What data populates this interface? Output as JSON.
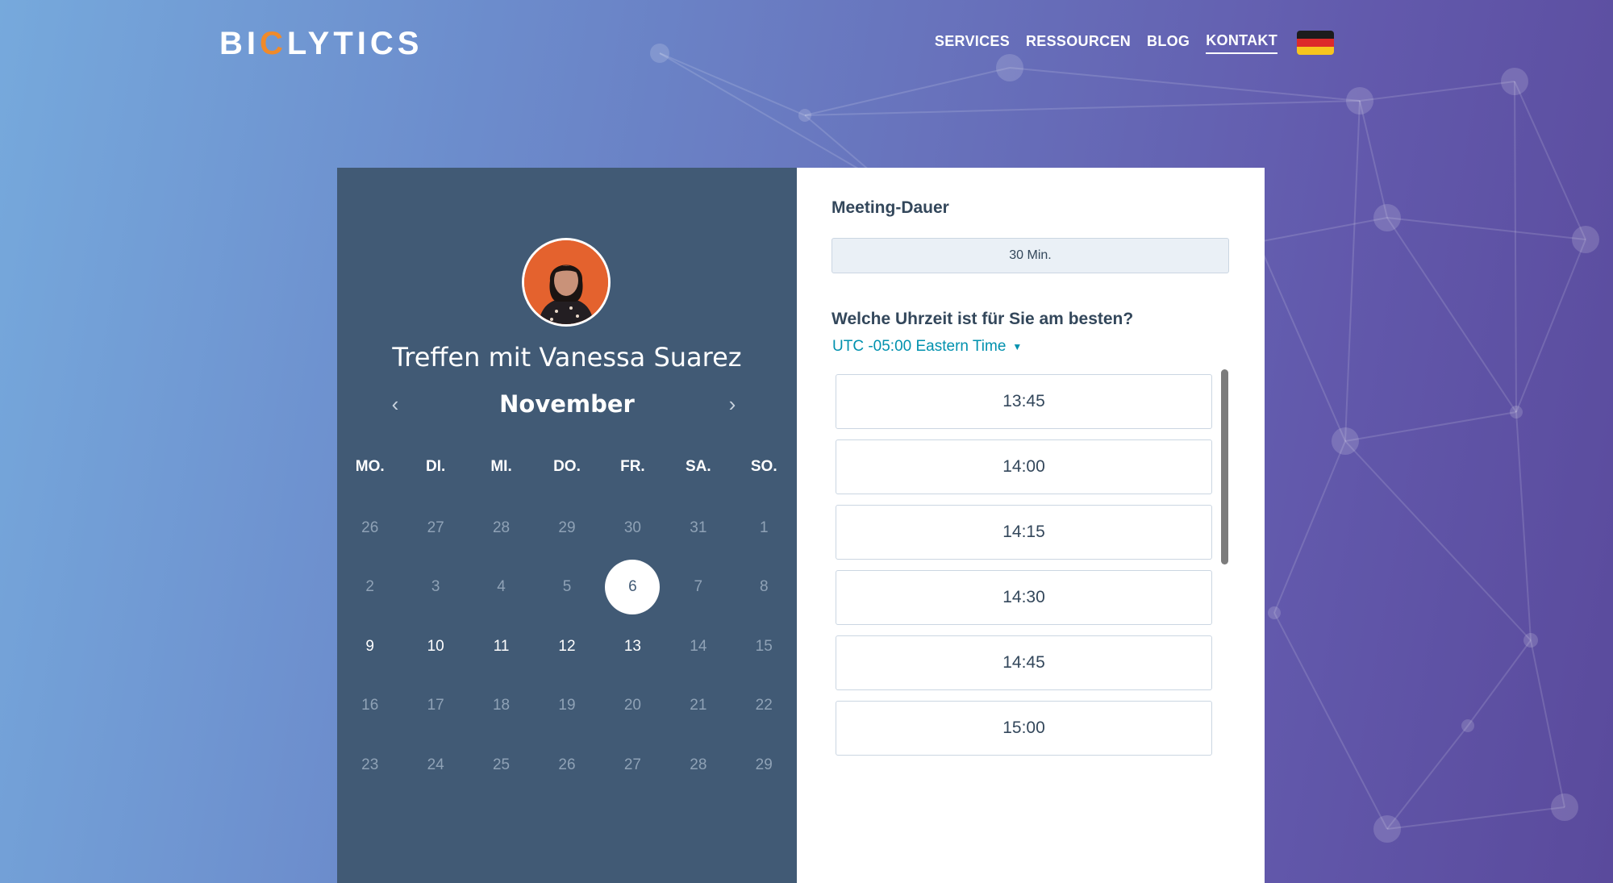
{
  "header": {
    "logo": {
      "part1": "BI",
      "part2": "C",
      "part3": "LYTICS"
    },
    "nav": [
      {
        "label": "SERVICES",
        "active": false
      },
      {
        "label": "RESSOURCEN",
        "active": false
      },
      {
        "label": "BLOG",
        "active": false
      },
      {
        "label": "KONTAKT",
        "active": true
      }
    ],
    "language_flag": "german-flag-icon"
  },
  "colors": {
    "left_panel": "#415a75",
    "accent_link": "#0091ae",
    "logo_accent": "#f08a2a",
    "text_dark": "#33475b"
  },
  "calendar": {
    "title": "Treffen mit Vanessa Suarez",
    "month": "November",
    "weekdays": [
      "MO.",
      "DI.",
      "MI.",
      "DO.",
      "FR.",
      "SA.",
      "SO."
    ],
    "weeks": [
      [
        {
          "d": "26",
          "s": "muted"
        },
        {
          "d": "27",
          "s": "muted"
        },
        {
          "d": "28",
          "s": "muted"
        },
        {
          "d": "29",
          "s": "muted"
        },
        {
          "d": "30",
          "s": "muted"
        },
        {
          "d": "31",
          "s": "muted"
        },
        {
          "d": "1",
          "s": "muted"
        }
      ],
      [
        {
          "d": "2",
          "s": "muted"
        },
        {
          "d": "3",
          "s": "muted"
        },
        {
          "d": "4",
          "s": "muted"
        },
        {
          "d": "5",
          "s": "muted"
        },
        {
          "d": "6",
          "s": "selected"
        },
        {
          "d": "7",
          "s": "muted"
        },
        {
          "d": "8",
          "s": "muted"
        }
      ],
      [
        {
          "d": "9",
          "s": "available"
        },
        {
          "d": "10",
          "s": "available"
        },
        {
          "d": "11",
          "s": "available"
        },
        {
          "d": "12",
          "s": "available"
        },
        {
          "d": "13",
          "s": "available"
        },
        {
          "d": "14",
          "s": "muted"
        },
        {
          "d": "15",
          "s": "muted"
        }
      ],
      [
        {
          "d": "16",
          "s": "muted"
        },
        {
          "d": "17",
          "s": "muted"
        },
        {
          "d": "18",
          "s": "muted"
        },
        {
          "d": "19",
          "s": "muted"
        },
        {
          "d": "20",
          "s": "muted"
        },
        {
          "d": "21",
          "s": "muted"
        },
        {
          "d": "22",
          "s": "muted"
        }
      ],
      [
        {
          "d": "23",
          "s": "muted"
        },
        {
          "d": "24",
          "s": "muted"
        },
        {
          "d": "25",
          "s": "muted"
        },
        {
          "d": "26",
          "s": "muted"
        },
        {
          "d": "27",
          "s": "muted"
        },
        {
          "d": "28",
          "s": "muted"
        },
        {
          "d": "29",
          "s": "muted"
        }
      ]
    ]
  },
  "booking": {
    "duration_label": "Meeting-Dauer",
    "duration_value": "30 Min.",
    "time_question": "Welche Uhrzeit ist für Sie am besten?",
    "timezone": "UTC -05:00 Eastern Time",
    "slots": [
      "13:45",
      "14:00",
      "14:15",
      "14:30",
      "14:45",
      "15:00"
    ]
  }
}
